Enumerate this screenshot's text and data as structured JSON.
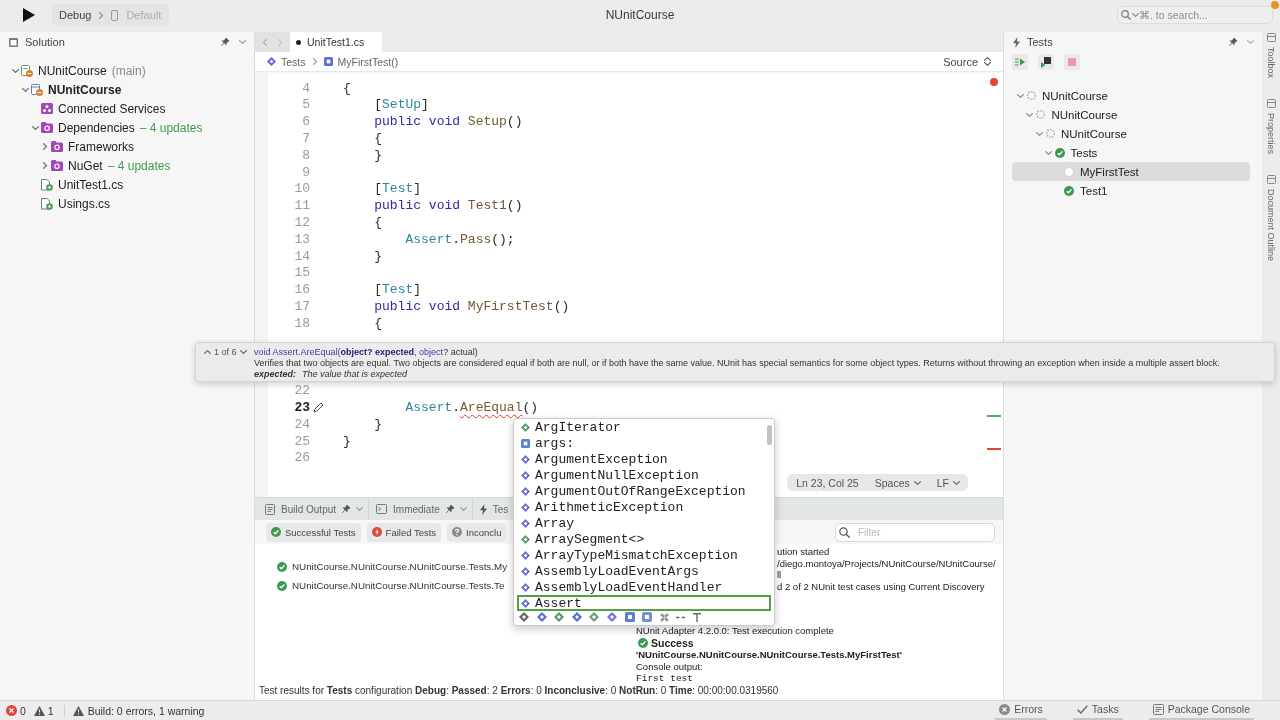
{
  "toolbar": {
    "configuration": "Debug",
    "device": "Default",
    "title": "NUnitCourse",
    "search_placeholder": "⌘. to search..."
  },
  "solution_pad": {
    "title": "Solution",
    "tree": [
      {
        "label": "NUnitCourse",
        "branch": "(main)",
        "kind": "solution",
        "expanded": true,
        "children": [
          {
            "label": "NUnitCourse",
            "kind": "project",
            "expanded": true,
            "children": [
              {
                "label": "Connected Services",
                "kind": "services"
              },
              {
                "label": "Dependencies",
                "updates": "– 4 updates",
                "kind": "folder",
                "expanded": true,
                "children": [
                  {
                    "label": "Frameworks",
                    "kind": "folder",
                    "expanded": false
                  },
                  {
                    "label": "NuGet",
                    "updates": "– 4 updates",
                    "kind": "folder",
                    "expanded": false
                  }
                ]
              },
              {
                "label": "UnitTest1.cs",
                "kind": "file"
              },
              {
                "label": "Usings.cs",
                "kind": "file"
              }
            ]
          }
        ]
      }
    ]
  },
  "editor": {
    "tabs": [
      {
        "label": "UnitTest1.cs",
        "modified": true,
        "selected": true
      }
    ],
    "breadcrumb": [
      {
        "label": "Tests",
        "kind": "class"
      },
      {
        "label": "MyFirstTest()",
        "kind": "method"
      }
    ],
    "view_mode": "Source",
    "code_blocks": [
      [
        {
          "number": "4",
          "current": false,
          "tokens": [
            {
              "text": "{",
              "kind": "plain"
            }
          ]
        },
        {
          "number": "5",
          "current": false,
          "tokens": [
            {
              "text": "    [",
              "kind": "plain"
            },
            {
              "text": "SetUp",
              "kind": "type"
            },
            {
              "text": "]",
              "kind": "plain"
            }
          ]
        },
        {
          "number": "6",
          "current": false,
          "tokens": [
            {
              "text": "    public void",
              "kind": "keyword"
            },
            {
              "text": " Setup",
              "kind": "method"
            },
            {
              "text": "()",
              "kind": "plain"
            }
          ]
        },
        {
          "number": "7",
          "current": false,
          "tokens": [
            {
              "text": "    {",
              "kind": "plain"
            }
          ]
        },
        {
          "number": "8",
          "current": false,
          "tokens": [
            {
              "text": "    }",
              "kind": "plain"
            }
          ]
        },
        {
          "number": "9",
          "current": false
        },
        {
          "number": "10",
          "current": false,
          "tokens": [
            {
              "text": "    [",
              "kind": "plain"
            },
            {
              "text": "Test",
              "kind": "type"
            },
            {
              "text": "]",
              "kind": "plain"
            }
          ]
        },
        {
          "number": "11",
          "current": false,
          "tokens": [
            {
              "text": "    public void",
              "kind": "keyword"
            },
            {
              "text": " Test1",
              "kind": "method"
            },
            {
              "text": "()",
              "kind": "plain"
            }
          ]
        },
        {
          "number": "12",
          "current": false,
          "tokens": [
            {
              "text": "    {",
              "kind": "plain"
            }
          ]
        },
        {
          "number": "13",
          "current": false,
          "tokens": [
            {
              "text": "        Assert",
              "kind": "type"
            },
            {
              "text": ".",
              "kind": "plain"
            },
            {
              "text": "Pass",
              "kind": "method"
            },
            {
              "text": "();",
              "kind": "plain"
            }
          ]
        },
        {
          "number": "14",
          "current": false,
          "tokens": [
            {
              "text": "    }",
              "kind": "plain"
            }
          ]
        },
        {
          "number": "15",
          "current": false
        },
        {
          "number": "16",
          "current": false,
          "tokens": [
            {
              "text": "    [",
              "kind": "plain"
            },
            {
              "text": "Test",
              "kind": "type"
            },
            {
              "text": "]",
              "kind": "plain"
            }
          ]
        },
        {
          "number": "17",
          "current": false,
          "tokens": [
            {
              "text": "    public void",
              "kind": "keyword"
            },
            {
              "text": " MyFirstTest",
              "kind": "method"
            },
            {
              "text": "()",
              "kind": "plain"
            }
          ]
        },
        {
          "number": "18",
          "current": false,
          "tokens": [
            {
              "text": "    {",
              "kind": "plain"
            }
          ]
        }
      ],
      [
        {
          "number": "22",
          "current": false
        },
        {
          "number": "23",
          "current": true,
          "tokens": [
            {
              "text": "        Assert",
              "kind": "type"
            },
            {
              "text": ".",
              "kind": "plain"
            },
            {
              "text": "AreEqual",
              "kind": "error"
            },
            {
              "text": "()",
              "kind": "plain"
            }
          ]
        },
        {
          "number": "24",
          "current": false,
          "tokens": [
            {
              "text": "    }",
              "kind": "plain"
            }
          ]
        },
        {
          "number": "25",
          "current": false,
          "tokens": [
            {
              "text": "}",
              "kind": "plain"
            }
          ]
        },
        {
          "number": "26",
          "current": false
        }
      ]
    ],
    "status": {
      "position": "Ln 23, Col 25",
      "indentation": "Spaces",
      "line_ending": "LF"
    }
  },
  "signature_help": {
    "counter": "1 of 6",
    "signature": [
      {
        "text": "void Assert.AreEqual(",
        "kind": "link"
      },
      {
        "text": "object? expected",
        "kind": "current"
      },
      {
        "text": ", ",
        "kind": "plain"
      },
      {
        "text": "object",
        "kind": "link"
      },
      {
        "text": "? actual)",
        "kind": "plain"
      }
    ],
    "summary": "Verifies that two objects are equal. Two objects are considered equal if both are null, or if both have the same value. NUnit has special semantics for some object types. Returns without throwing an exception when inside a multiple assert block.",
    "param_name": "expected:",
    "param_doc": "The value that is expected"
  },
  "completion": {
    "items": [
      {
        "label": "ArgIterator",
        "kind": "struct",
        "selected": false
      },
      {
        "label": "args:",
        "kind": "parameter",
        "selected": false
      },
      {
        "label": "ArgumentException",
        "kind": "class",
        "selected": false
      },
      {
        "label": "ArgumentNullException",
        "kind": "class",
        "selected": false
      },
      {
        "label": "ArgumentOutOfRangeException",
        "kind": "class",
        "selected": false
      },
      {
        "label": "ArithmeticException",
        "kind": "class",
        "selected": false
      },
      {
        "label": "Array",
        "kind": "class",
        "selected": false
      },
      {
        "label": "ArraySegment<>",
        "kind": "struct",
        "selected": false
      },
      {
        "label": "ArrayTypeMismatchException",
        "kind": "class",
        "selected": false
      },
      {
        "label": "AssemblyLoadEventArgs",
        "kind": "class",
        "selected": false
      },
      {
        "label": "AssemblyLoadEventHandler",
        "kind": "class",
        "selected": false
      },
      {
        "label": "Assert",
        "kind": "class",
        "selected": true
      }
    ]
  },
  "bottom_panel": {
    "tabs": [
      {
        "label": "Build Output",
        "kind": "build"
      },
      {
        "label": "Immediate",
        "kind": "immediate"
      },
      {
        "label": "Tes",
        "kind": "tests"
      }
    ],
    "filters": [
      {
        "label": "Successful Tests",
        "kind": "passed"
      },
      {
        "label": "Failed Tests",
        "kind": "failed"
      },
      {
        "label": "Inconclu",
        "kind": "inconclusive"
      }
    ],
    "filter_placeholder": "Filter",
    "results": [
      {
        "label": "NUnitCourse.NUnitCourse.NUnitCourse.Tests.My",
        "kind": "passed"
      },
      {
        "label": "NUnitCourse.NUnitCourse.NUnitCourse.Tests.Te",
        "kind": "passed"
      }
    ],
    "output_clipped": [
      "ution started",
      "/diego.montoya/Projects/NUnitCourse/NUnitCourse/",
      "ll",
      "d 2 of 2 NUnit test cases using Current Discovery"
    ],
    "output": [
      {
        "text": "NUnit Adapter 4.2.0.0: Test execution complete",
        "kind": "plain"
      },
      {
        "text": "Success",
        "kind": "success"
      },
      {
        "text": "'NUnitCourse.NUnitCourse.NUnitCourse.Tests.MyFirstTest'",
        "kind": "bold"
      },
      {
        "text": "Console output:",
        "kind": "plain"
      },
      {
        "text": "First test",
        "kind": "console"
      }
    ],
    "summary": "Test results for **Tests** configuration **Debug**: **Passed**: 2 **Errors**: 0 **Inconclusive**: 0 **NotRun**: 0 **Time**: 00:00:00.0319560"
  },
  "tests_pad": {
    "title": "Tests",
    "tree": [
      {
        "label": "NUnitCourse",
        "kind": "not_run",
        "expanded": true,
        "selected": false,
        "children": [
          {
            "label": "NUnitCourse",
            "kind": "not_run",
            "expanded": true,
            "selected": false,
            "children": [
              {
                "label": "NUnitCourse",
                "kind": "not_run",
                "expanded": true,
                "selected": false,
                "children": [
                  {
                    "label": "Tests",
                    "kind": "passed",
                    "expanded": true,
                    "selected": false,
                    "children": [
                      {
                        "label": "MyFirstTest",
                        "kind": "pending",
                        "selected": true
                      },
                      {
                        "label": "Test1",
                        "kind": "passed",
                        "selected": false
                      }
                    ]
                  }
                ]
              }
            ]
          }
        ]
      }
    ]
  },
  "side_tabs": [
    "Toolbox",
    "Properties",
    "Document Outline"
  ],
  "status_bar": {
    "errors": "0",
    "warnings": "1",
    "build": "Build: 0 errors, 1 warning",
    "pads": [
      {
        "label": "Errors",
        "kind": "errors"
      },
      {
        "label": "Tasks",
        "kind": "tasks"
      },
      {
        "label": "Package Console",
        "kind": "console"
      }
    ]
  }
}
